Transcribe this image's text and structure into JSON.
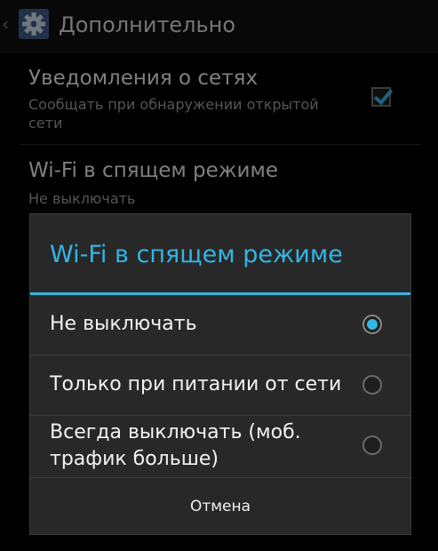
{
  "actionbar": {
    "back_icon": "chevron-left-icon",
    "app_icon": "gear-icon",
    "title": "Дополнительно"
  },
  "prefs": [
    {
      "title": "Уведомления о сетях",
      "summary": "Сообщать при обнаружении открытой сети",
      "checked": true
    },
    {
      "title": "Wi-Fi в спящем режиме",
      "summary": "Не выключать"
    }
  ],
  "dialog": {
    "title": "Wi-Fi в спящем режиме",
    "options": [
      {
        "label": "Не выключать",
        "selected": true
      },
      {
        "label": "Только при питании от сети",
        "selected": false
      },
      {
        "label": "Всегда выключать (моб. трафик больше)",
        "selected": false
      }
    ],
    "cancel_label": "Отмена"
  },
  "colors": {
    "accent": "#33b5e5",
    "dialog_bg": "#282828",
    "screen_bg": "#000000"
  }
}
